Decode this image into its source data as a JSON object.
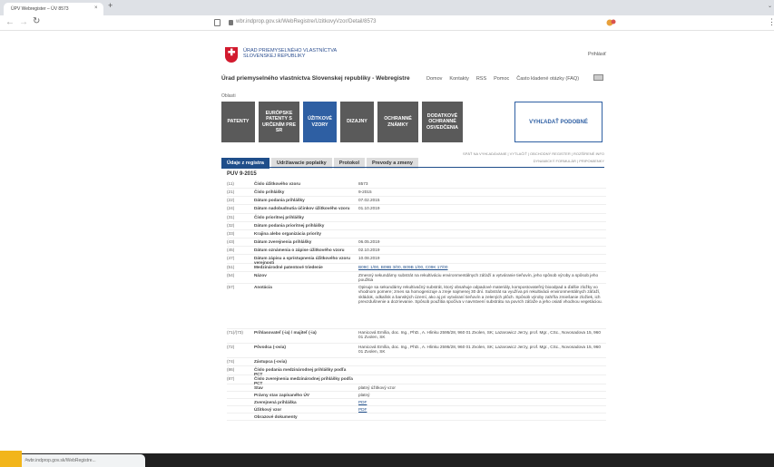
{
  "browser": {
    "tab_title": "ÚPV Webregister – ÚV 8573",
    "close_glyph": "×",
    "newtab_glyph": "+",
    "chevron_glyph": "⌄",
    "back_glyph": "←",
    "forward_glyph": "→",
    "reload_glyph": "↻",
    "url": "wbr.indprop.gov.sk/WebRegistre/UzitkovyVzor/Detail/8573",
    "menu_glyph": "⋮",
    "status_url": "wbr.indprop.gov.sk/WebRegistre...",
    "search_glyph": "⌕"
  },
  "header": {
    "logo_glyph": "✚",
    "office_name": "Úrad priemyselného vlastníctva Slovenskej republiky",
    "login": "Prihlásiť",
    "site_title": "Úrad priemyselného vlastníctva Slovenskej republiky - Webregistre",
    "nav": [
      "Domov",
      "Kontakty",
      "RSS",
      "Pomoc",
      "Často kladené otázky (FAQ)"
    ],
    "section_label": "Oblasti"
  },
  "tiles": [
    {
      "label": "Patenty",
      "active": false,
      "wide": false
    },
    {
      "label": "Európske patenty s určením pre SR",
      "active": false,
      "wide": true
    },
    {
      "label": "Úžitkové vzory",
      "active": true,
      "wide": false
    },
    {
      "label": "Dizajny",
      "active": false,
      "wide": false
    },
    {
      "label": "Ochranné známky",
      "active": false,
      "wide": false
    },
    {
      "label": "Dodatkové ochranné osvedčenia",
      "active": false,
      "wide": true
    }
  ],
  "search_button": "Vyhľadať podobné",
  "sub_links": {
    "line1": "Späť na vyhľadávanie  |  Vytlačiť  |  Obchodný register  |  Rozšírené info",
    "line2": "Dynamický formulár  |  Pripomienky"
  },
  "page_tabs": [
    "Údaje z registra",
    "Udržiavacie poplatky",
    "Protokol",
    "Prevody a zmeny"
  ],
  "record_id": "PUV 9-2015",
  "rows": [
    {
      "code": "(11)",
      "label": "Číslo úžitkového vzoru",
      "value": "8573"
    },
    {
      "code": "(21)",
      "label": "Číslo prihlášky",
      "value": "9-2015"
    },
    {
      "code": "(22)",
      "label": "Dátum podania prihlášky",
      "value": "07.02.2015"
    },
    {
      "code": "(24)",
      "label": "Dátum nadobudnutia účinkov úžitkového vzoru",
      "value": "01.10.2019"
    },
    {
      "code": "(31)",
      "label": "Číslo prioritnej prihlášky",
      "value": ""
    },
    {
      "code": "(32)",
      "label": "Dátum podania prioritnej prihlášky",
      "value": ""
    },
    {
      "code": "(33)",
      "label": "Krajina alebo organizácia priority",
      "value": ""
    },
    {
      "code": "(43)",
      "label": "Dátum zverejnenia prihlášky",
      "value": "06.05.2019"
    },
    {
      "code": "(45)",
      "label": "Dátum oznámenia o zápise úžitkového vzoru",
      "value": "02.10.2019"
    },
    {
      "code": "(47)",
      "label": "Dátum zápisu a sprístupnenia úžitkového vzoru verejnosti",
      "value": "10.08.2019"
    },
    {
      "code": "(51)",
      "label": "Medzinárodné patentové triedenie",
      "value": "B09C 1/00, B09B 3/00, B09B 1/00, C09K 17/00",
      "link": true
    },
    {
      "code": "(54)",
      "label": "Názov",
      "value": "Zmesný sekundárny substrát na rekultiváciu environmentálnych záťaží a vytváranie tieňovín, jeho spôsob výroby a spôsob jeho použitia"
    },
    {
      "code": "(57)",
      "label": "Anotácia",
      "value": "Opisuje sa sekundárny rekultivačný substrát, ktorý obsahuje odpadové materiály, kompostovateľný bioodpad a ďalšie zložky vo vhodnom pomere; zmes sa homogenizuje a zreje najmenej 30 dní. Substrát sa využíva pri rekultivácii environmentálnych záťaží, skládok, odkalísk a banských území, ako aj pri vytváraní tieňovín a zelených plôch. Spôsob výroby zahŕňa zmiešanie zložiek, ich prevzdušnenie a dozrievanie. Spôsob použitia spočíva v navrstvení substrátu na povrch záťaže a jeho osiatí vhodnou vegetáciou."
    },
    {
      "code": "(71)/(73)",
      "label": "Prihlasovateľ (-ia) / majiteľ (-ia)",
      "value": "Hanicová Emília, doc. Ing., PhD., A. Hlinku 2595/28, 960 01 Zvolen, SK; Lazarowicz Jerzy, prof. Mgr., CSc., Novosadova 15, 960 01 Zvolen, SK"
    },
    {
      "code": "(72)",
      "label": "Pôvodca (-ovia)",
      "value": "Hanicová Emília, doc. Ing., PhD., A. Hlinku 2595/28, 960 01 Zvolen, SK; Lazarowicz Jerzy, prof. Mgr., CSc., Novosadova 15, 960 01 Zvolen, SK"
    },
    {
      "code": "(74)",
      "label": "Zástupca (-ovia)",
      "value": ""
    },
    {
      "code": "(86)",
      "label": "Číslo podania medzinárodnej prihlášky podľa PCT",
      "value": ""
    },
    {
      "code": "(87)",
      "label": "Číslo zverejnenia medzinárodnej prihlášky podľa PCT",
      "value": ""
    },
    {
      "code": "",
      "label": "Stav",
      "value": "platný úžitkový vzor"
    },
    {
      "code": "",
      "label": "Právny stav zapísaného ÚV",
      "value": "platný"
    },
    {
      "code": "",
      "label": "Zverejnená prihláška",
      "value": "PDF",
      "link": true
    },
    {
      "code": "",
      "label": "Úžitkový vzor",
      "value": "PDF",
      "link": true
    },
    {
      "code": "",
      "label": "Obrazové dokumenty",
      "value": ""
    }
  ]
}
